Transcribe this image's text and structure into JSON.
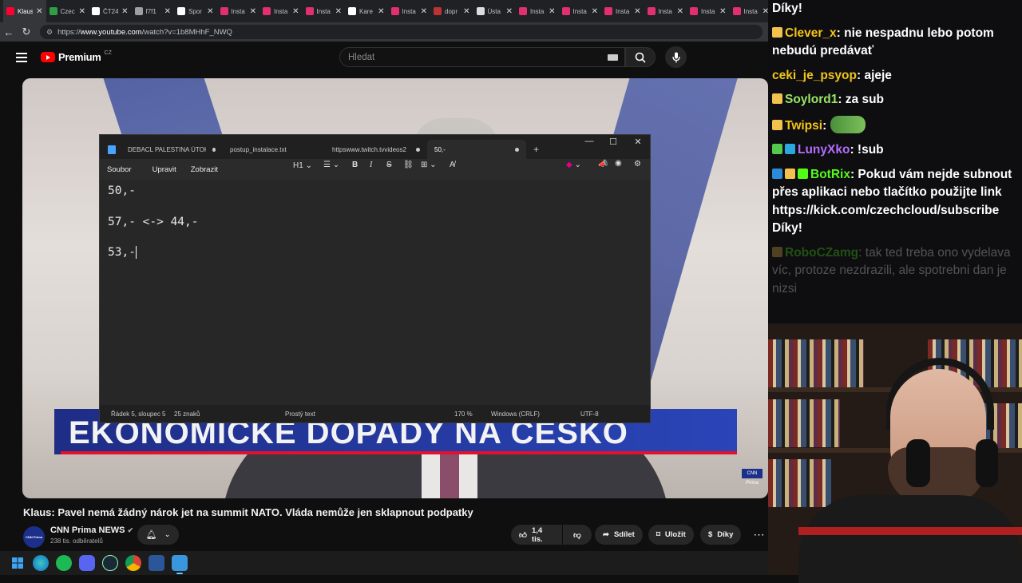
{
  "browser": {
    "tabs": [
      {
        "label": "Klaus",
        "color": "#ff0033",
        "active": true
      },
      {
        "label": "Czec",
        "color": "#2f9e44"
      },
      {
        "label": "ČT24",
        "color": "#ffffff"
      },
      {
        "label": "f7f1",
        "color": "#9aa0a6"
      },
      {
        "label": "Spor",
        "color": "#ffffff"
      },
      {
        "label": "Insta",
        "color": "#e1306c"
      },
      {
        "label": "Insta",
        "color": "#e1306c"
      },
      {
        "label": "Insta",
        "color": "#e1306c"
      },
      {
        "label": "Kare",
        "color": "#ffffff"
      },
      {
        "label": "Insta",
        "color": "#e1306c"
      },
      {
        "label": "dopr",
        "color": "#b33"
      },
      {
        "label": "Ústa",
        "color": "#ddd"
      },
      {
        "label": "Insta",
        "color": "#e1306c"
      },
      {
        "label": "Insta",
        "color": "#e1306c"
      },
      {
        "label": "Insta",
        "color": "#e1306c"
      },
      {
        "label": "Insta",
        "color": "#e1306c"
      },
      {
        "label": "Insta",
        "color": "#e1306c"
      },
      {
        "label": "Insta",
        "color": "#e1306c"
      }
    ],
    "url_prefix": "https://",
    "url_host": "www.youtube.com",
    "url_path": "/watch?v=1b8MHhF_NWQ"
  },
  "youtube": {
    "logo_text": "Premium",
    "region": "CZ",
    "search_placeholder": "Hledat",
    "video_title": "Klaus: Pavel nemá žádný nárok jet na summit NATO. Vláda nemůže jen sklapnout podpatky",
    "channel_name": "CNN Prima NEWS",
    "channel_logo": "CNN Prima NEWS",
    "subscribers": "238 tis. odběratelů",
    "likes": "1,4 tis.",
    "share_label": "Sdílet",
    "save_label": "Uložit",
    "thanks_label": "Díky",
    "banner_text": "EKONOMICKÉ DOPADY NA ČESKO",
    "watermark": "CNN Prima"
  },
  "notepad": {
    "tabs": [
      {
        "label": "DEBACL PALESTINA ÚTOK.tx",
        "dirty": true
      },
      {
        "label": "postup_instalace.txt",
        "dirty": false
      },
      {
        "label": "httpswww.twitch.tvvideos2",
        "dirty": true
      },
      {
        "label": "50,-",
        "dirty": true,
        "active": true
      }
    ],
    "menu": [
      "Soubor",
      "Upravit",
      "Zobrazit"
    ],
    "heading_style": "H1",
    "lines": [
      "50,-",
      "",
      "57,- <-> 44,-",
      "",
      "53,-"
    ],
    "status": {
      "position": "Řádek 5, sloupec 5",
      "chars": "25 znaků",
      "format": "Prostý text",
      "zoom": "170 %",
      "line_ending": "Windows (CRLF)",
      "encoding": "UTF-8"
    }
  },
  "chat": [
    {
      "user": "",
      "text": "Díky!",
      "color": "#ffffff",
      "badges": []
    },
    {
      "user": "Clever_x",
      "text": "nie nespadnu lebo potom nebudú predávať",
      "color": "#f5c518",
      "badges": [
        "#f2c14e"
      ]
    },
    {
      "user": "ceki_je_psyop",
      "text": "ajeje",
      "color": "#f0c419",
      "badges": []
    },
    {
      "user": "Soylord1",
      "text": "za sub",
      "color": "#9be564",
      "badges": [
        "#f2c14e"
      ]
    },
    {
      "user": "Twipsi",
      "text": "",
      "color": "#f5c518",
      "badges": [
        "#f2c14e"
      ],
      "emote": true
    },
    {
      "user": "LunyXko",
      "text": "!sub",
      "color": "#b66cff",
      "badges": [
        "#53c94d",
        "#2aa7e0"
      ]
    },
    {
      "user": "BotRix",
      "text": "Pokud vám nejde subnout přes aplikaci nebo tlačítko použijte link https://kick.com/czechcloud/subscribe Díky!",
      "color": "#53fc18",
      "badges": [
        "#2a8bd8",
        "#f2c14e",
        "#53fc18"
      ]
    },
    {
      "user": "RoboCZamg",
      "text": "tak ted treba ono vydelava víc, protoze nezdrazili, ale spotrebni dan je nizsi",
      "color": "#53fc18",
      "badges": [
        "#f2c14e"
      ],
      "faded": true
    }
  ]
}
